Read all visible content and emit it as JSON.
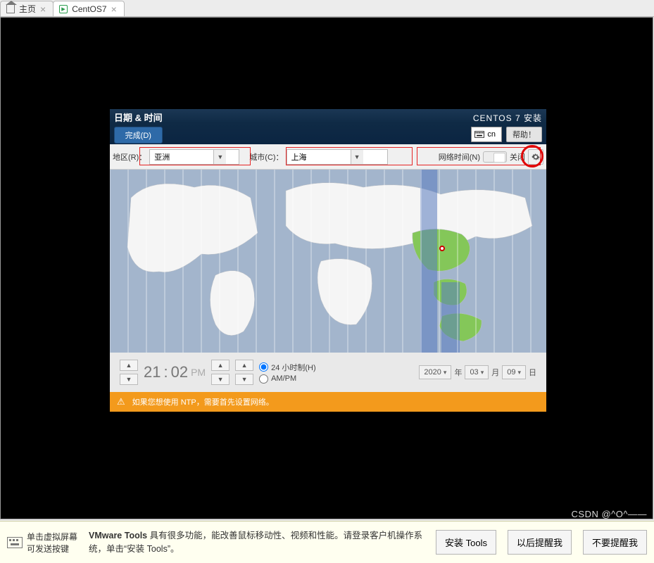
{
  "tabs": {
    "home": "主页",
    "vm": "CentOS7"
  },
  "installer": {
    "title": "日期 & 时间",
    "done": "完成(D)",
    "name": "CENTOS 7 安装",
    "kb": "cn",
    "help": "帮助！",
    "labels": {
      "region": "地区(R)：",
      "city": "城市(C)：",
      "net": "网络时间(N)",
      "net_state": "关闭"
    },
    "region": "亚洲",
    "city": "上海",
    "time": {
      "hh": "21",
      "mm": "02",
      "pm": "PM",
      "fmt24": "24 小时制(H)",
      "fmtAP": "AM/PM"
    },
    "date": {
      "year": "2020",
      "year_lbl": "年",
      "month": "03",
      "month_lbl": "月",
      "day": "09",
      "day_lbl": "日"
    },
    "warn": "如果您想使用 NTP，需要首先设置网络。"
  },
  "vmbar": {
    "hint": "单击虚拟屏幕\n可发送按键",
    "msg_b1": "VMware Tools ",
    "msg_1": "具有很多功能，能改善鼠标移动性、视频和性能。请登录客户机操作系统，单击“安装 Tools”。",
    "btn_install": "安装 Tools",
    "btn_later": "以后提醒我",
    "btn_never": "不要提醒我"
  },
  "watermark": "CSDN @^O^——"
}
